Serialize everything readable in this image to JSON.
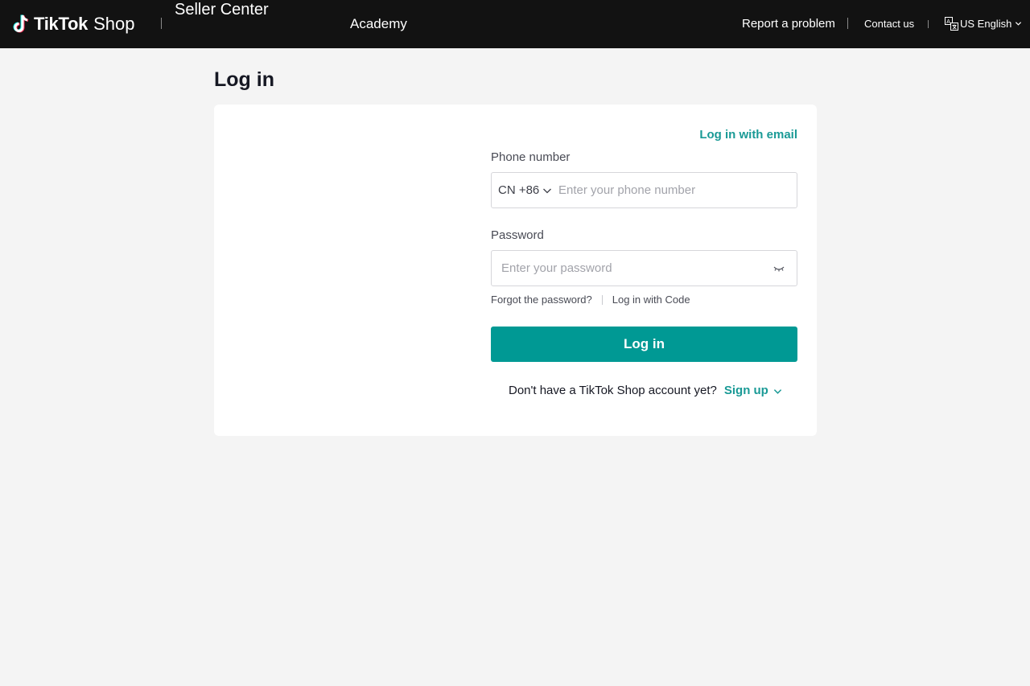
{
  "header": {
    "brand_name": "TikTok",
    "brand_suffix": "Shop",
    "product_name": "Seller Center",
    "nav_academy": "Academy",
    "report_problem": "Report a problem",
    "contact_us": "Contact us",
    "language": "US English"
  },
  "page": {
    "title": "Log in"
  },
  "login_form": {
    "alt_login_link": "Log in with email",
    "phone_label": "Phone number",
    "country_code": "CN +86",
    "phone_placeholder": "Enter your phone number",
    "password_label": "Password",
    "password_placeholder": "Enter your password",
    "forgot_password": "Forgot the password?",
    "login_with_code": "Log in with Code",
    "submit_label": "Log in",
    "no_account_text": "Don't have a TikTok Shop account yet?",
    "signup_label": "Sign up"
  },
  "icons": {
    "logo": "tiktok-logo-icon",
    "language": "translate-icon",
    "chevron": "chevron-down-icon",
    "password_toggle": "eye-closed-icon"
  },
  "colors": {
    "header_bg": "#121212",
    "accent": "#009994",
    "link": "#1a9a96",
    "page_bg": "#f4f4f4"
  }
}
